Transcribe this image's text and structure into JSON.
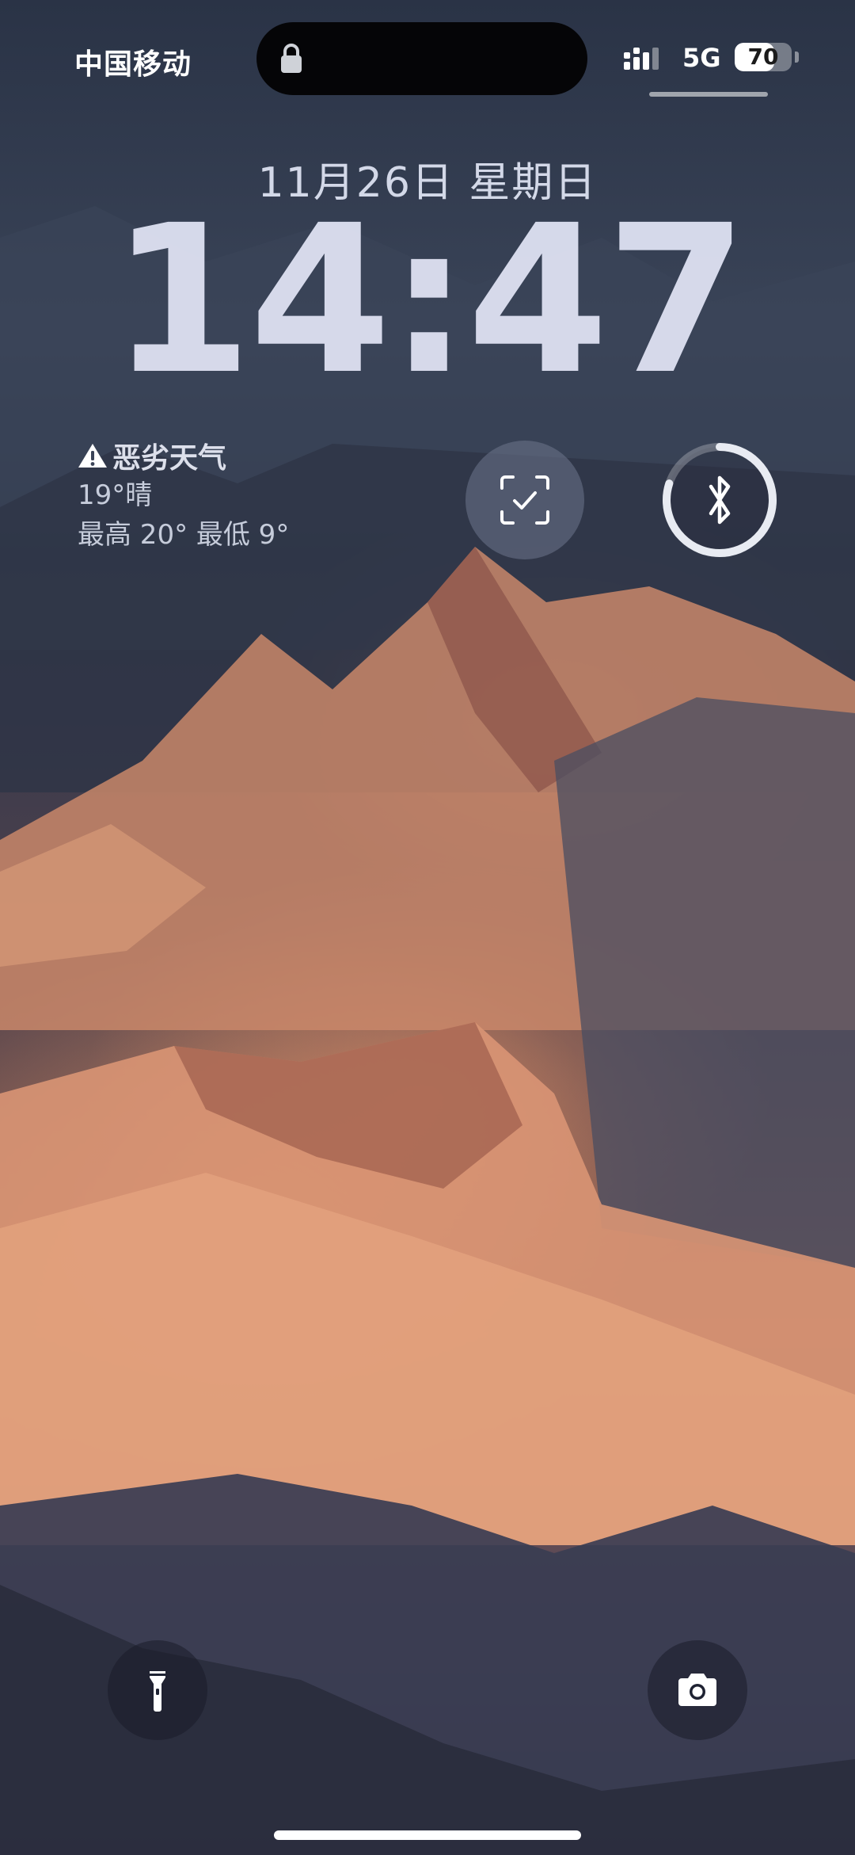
{
  "status_bar": {
    "carrier": "中国移动",
    "network_type": "5G",
    "battery_level": "70",
    "battery_fraction": 0.7
  },
  "lock_screen": {
    "date": "11月26日 星期日",
    "time": "14:47"
  },
  "weather_widget": {
    "alert": "恶劣天气",
    "current": "19°晴",
    "range": "最高 20° 最低 9°"
  },
  "widgets": {
    "scan_icon": "scan-check-icon",
    "bluetooth_icon": "bluetooth-icon",
    "bluetooth_battery_fraction": 0.8
  },
  "controls": {
    "flashlight_icon": "flashlight-icon",
    "camera_icon": "camera-icon"
  },
  "colors": {
    "text": "#e2e6f2",
    "widget_bg": "#6e768c"
  }
}
